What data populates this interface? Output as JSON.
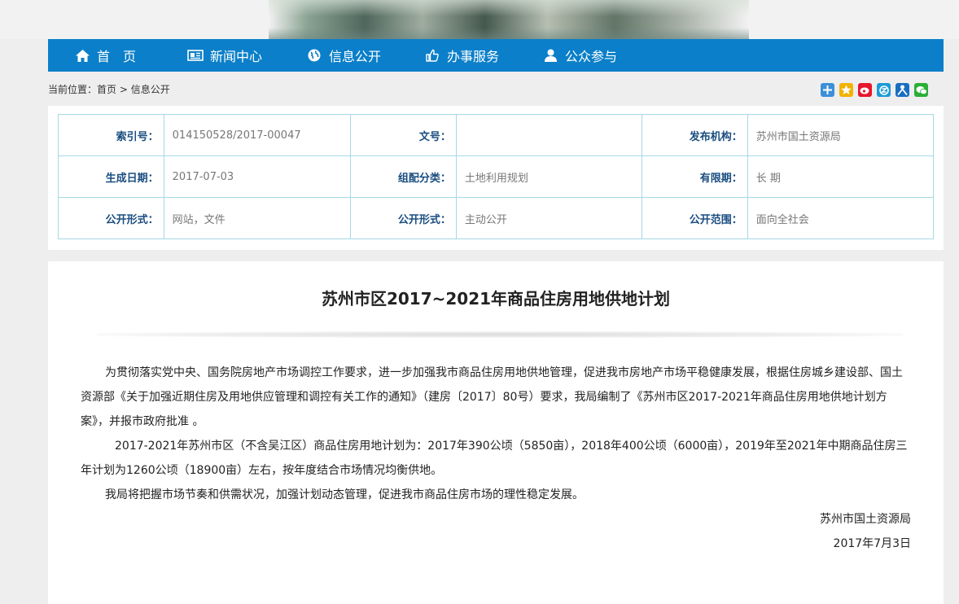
{
  "nav": {
    "items": [
      {
        "label": "首　页",
        "icon": "home-icon"
      },
      {
        "label": "新闻中心",
        "icon": "newspaper-icon"
      },
      {
        "label": "信息公开",
        "icon": "globe-icon"
      },
      {
        "label": "办事服务",
        "icon": "thumbs-up-icon"
      },
      {
        "label": "公众参与",
        "icon": "user-icon"
      }
    ]
  },
  "breadcrumb": {
    "prefix": "当前位置：",
    "home": "首页",
    "sep": " > ",
    "current": "信息公开"
  },
  "share_icons": [
    "plus-share-icon",
    "star-bookmark-icon",
    "weibo-icon",
    "qq-zone-icon",
    "renren-icon",
    "wechat-icon"
  ],
  "meta": {
    "rows": [
      [
        {
          "key": "索引号：",
          "value": "014150528/2017-00047"
        },
        {
          "key": "文号：",
          "value": ""
        },
        {
          "key": "发布机构：",
          "value": "苏州市国土资源局"
        }
      ],
      [
        {
          "key": "生成日期：",
          "value": "2017-07-03"
        },
        {
          "key": "组配分类：",
          "value": "土地利用规划"
        },
        {
          "key": "有限期：",
          "value": "长 期"
        }
      ],
      [
        {
          "key": "公开形式：",
          "value": "网站，文件"
        },
        {
          "key": "公开形式：",
          "value": "主动公开"
        },
        {
          "key": "公开范围：",
          "value": "面向全社会"
        }
      ]
    ]
  },
  "article": {
    "title": "苏州市区2017~2021年商品住房用地供地计划",
    "paragraphs": [
      "为贯彻落实党中央、国务院房地产市场调控工作要求，进一步加强我市商品住房用地供地管理，促进我市房地产市场平稳健康发展，根据住房城乡建设部、国土资源部《关于加强近期住房及用地供应管理和调控有关工作的通知》（建房〔2017〕80号）要求，我局编制了《苏州市区2017-2021年商品住房用地供地计划方案》，并报市政府批准 。",
      "2017-2021年苏州市区（不含吴江区）商品住房用地计划为：2017年390公顷（5850亩），2018年400公顷（6000亩），2019年至2021年中期商品住房三年计划为1260公顷（18900亩）左右，按年度结合市场情况均衡供地。",
      "我局将把握市场节奏和供需状况，加强计划动态管理，促进我市商品住房市场的理性稳定发展。"
    ],
    "signature_org": "苏州市国土资源局",
    "signature_date": "2017年7月3日"
  }
}
